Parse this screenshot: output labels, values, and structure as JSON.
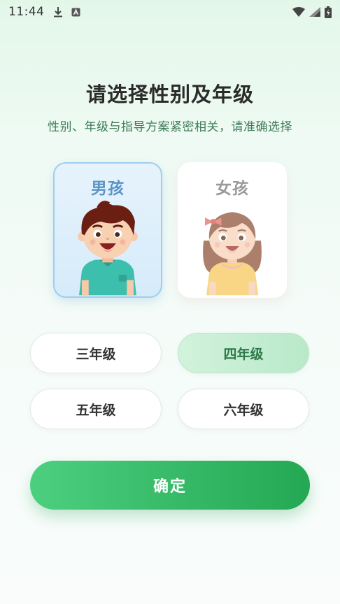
{
  "status_bar": {
    "time": "11:44"
  },
  "header": {
    "title": "请选择性别及年级",
    "subtitle": "性别、年级与指导方案紧密相关，请准确选择"
  },
  "gender": {
    "options": [
      {
        "label": "男孩",
        "selected": true
      },
      {
        "label": "女孩",
        "selected": false
      }
    ]
  },
  "grades": {
    "options": [
      {
        "label": "三年级",
        "selected": false
      },
      {
        "label": "四年级",
        "selected": true
      },
      {
        "label": "五年级",
        "selected": false
      },
      {
        "label": "六年级",
        "selected": false
      }
    ]
  },
  "actions": {
    "confirm_label": "确定"
  },
  "colors": {
    "accent_green": "#24a853",
    "selected_grade_bg": "#c6eed3",
    "boy_card_border": "#9fcdf0",
    "subtitle_green": "#3d7b58"
  }
}
